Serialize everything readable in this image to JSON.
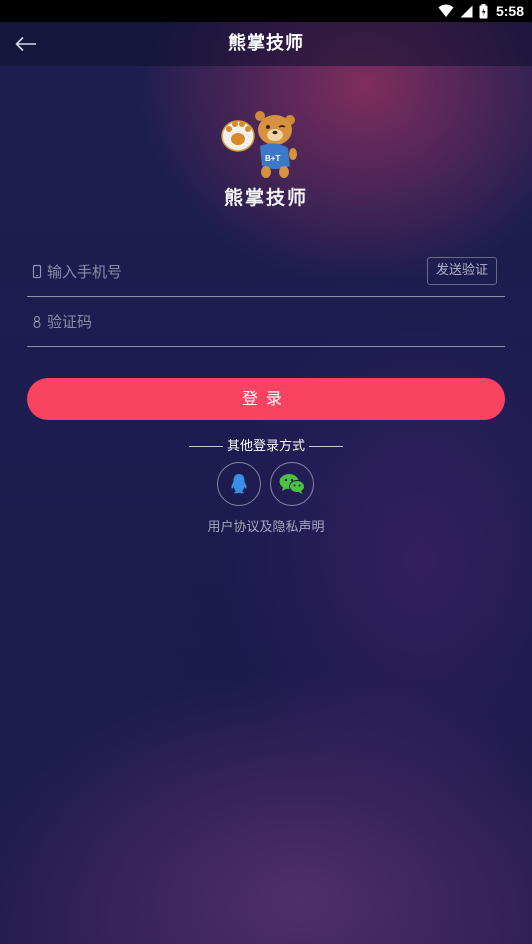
{
  "status_bar": {
    "time": "5:58",
    "icons": [
      "wifi-icon",
      "cell-signal-icon",
      "battery-icon"
    ]
  },
  "app_bar": {
    "title": "熊掌技师",
    "back_icon": "arrow-left-icon"
  },
  "logo": {
    "name": "熊掌技师",
    "mascot_badge_text": "B+T"
  },
  "form": {
    "phone": {
      "placeholder": "输入手机号",
      "value": "",
      "icon": "phone-icon"
    },
    "code": {
      "placeholder": "验证码",
      "value": "",
      "icon": "lock-icon"
    },
    "send_code_label": "发送验证",
    "login_label": "登录"
  },
  "other_login": {
    "label": "其他登录方式",
    "options": [
      "qq-icon",
      "wechat-icon"
    ]
  },
  "agreement": {
    "label": "用户协议及隐私声明"
  },
  "colors": {
    "accent": "#fa4360",
    "wechat": "#4bc341",
    "qq": "#3a8ee6",
    "background": "#1b1f4e"
  }
}
